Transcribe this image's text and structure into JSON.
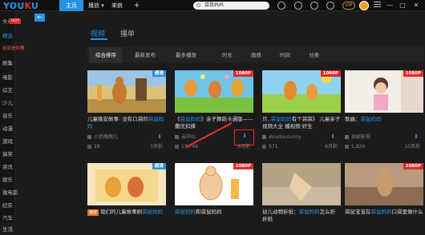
{
  "header": {
    "logo_main": "YOU",
    "logo_k": "K",
    "logo_end": "U",
    "nav": [
      {
        "label": "主页"
      },
      {
        "label": "播放 ▾"
      },
      {
        "label": "来疯"
      },
      {
        "label": "+"
      }
    ],
    "search_value": "袋鼠妈妈",
    "vip_label": "VIP",
    "window_controls": [
      "—",
      "□",
      "✕"
    ]
  },
  "sidebar": {
    "items": [
      {
        "label": "头条",
        "badge": "HOT"
      },
      {
        "label": "精选"
      },
      {
        "label": "这就是街舞"
      },
      {
        "label": "剧集"
      },
      {
        "label": "电影"
      },
      {
        "label": "综艺"
      },
      {
        "label": "少儿"
      },
      {
        "label": "音乐"
      },
      {
        "label": "动漫"
      },
      {
        "label": "游戏"
      },
      {
        "label": "搞笑"
      },
      {
        "label": "资讯"
      },
      {
        "label": "娱乐"
      },
      {
        "label": "微电影"
      },
      {
        "label": "纪实"
      },
      {
        "label": "汽车"
      },
      {
        "label": "生活"
      }
    ]
  },
  "back_label": "←",
  "tabs": {
    "video": "视频",
    "playlist": "播单"
  },
  "filters": [
    {
      "label": "综合排序",
      "active": true
    },
    {
      "label": "最新发布"
    },
    {
      "label": "最多播放"
    },
    {
      "label": "时长"
    },
    {
      "label": "画质"
    },
    {
      "label": "时间"
    },
    {
      "label": "分类"
    }
  ],
  "cards_row1": [
    {
      "badge": "超清",
      "badge_color": "blue",
      "title_pre": "儿童晚安故事: 没有口袋的",
      "title_hl": "袋鼠妈妈",
      "title_post": "",
      "author": "小奶瓶晚儿",
      "views": "28",
      "date": "3天前"
    },
    {
      "badge": "1080P",
      "badge_color": "hd",
      "title_pre": "《",
      "title_hl": "袋鼠妈妈",
      "title_post": "》亲子舞蹈卡通版——撒优扣撑",
      "author": "云中山",
      "views": "13,749",
      "date": "6月前"
    },
    {
      "badge": "1080P",
      "badge_color": "hd",
      "title_pre": "贝..",
      "title_hl": "袋鼠妈妈",
      "title_post": "有个袋袋》 儿童亲子视频大全 播视频·好生",
      "author": "doudousunny",
      "views": "971",
      "date": "6月前"
    },
    {
      "badge": "1080P",
      "badge_color": "hd",
      "title_pre": "歌曲：",
      "title_hl": "袋鼠妈妈",
      "title_post": "",
      "author": "孩妮影视",
      "views": "1,826",
      "date": "10月前"
    }
  ],
  "cards_row2": [
    {
      "badge": "超清",
      "badge_color": "blue",
      "title_tag": "播放",
      "title_pre": "我们的儿童故事剧",
      "title_hl": "袋鼠妈妈",
      "title_post": ""
    },
    {
      "badge": "1080P",
      "badge_color": "hd",
      "title_tag": "",
      "title_pre": "",
      "title_hl": "袋鼠妈妈",
      "title_post": "和袋鼠妈妈"
    },
    {
      "badge": "",
      "badge_color": "",
      "title_tag": "",
      "title_pre": "幼儿动物折纸：",
      "title_hl": "袋鼠妈妈",
      "title_post": "怎么折 折纸"
    },
    {
      "badge": "1080P",
      "badge_color": "hd",
      "title_tag": "",
      "title_pre": "袋鼠宝宝在",
      "title_hl": "袋鼠妈妈",
      "title_post": "口袋里做什么"
    }
  ]
}
